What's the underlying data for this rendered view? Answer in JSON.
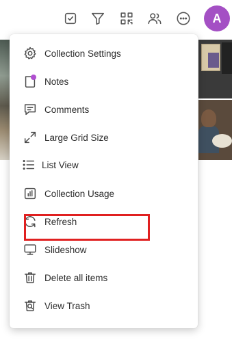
{
  "colors": {
    "avatar_bg": "#a450c4",
    "notes_dot": "#b04fd0",
    "highlight_border": "#e02020"
  },
  "toolbar": {
    "icons": [
      "checkbox-icon",
      "filter-icon",
      "qr-code-icon",
      "users-icon",
      "more-options-icon"
    ],
    "avatar_initial": "A"
  },
  "menu": {
    "items": [
      {
        "label": "Collection Settings",
        "icon": "gear-icon"
      },
      {
        "label": "Notes",
        "icon": "notes-icon"
      },
      {
        "label": "Comments",
        "icon": "comment-icon"
      },
      {
        "label": "Large Grid Size",
        "icon": "expand-icon"
      },
      {
        "label": "List View",
        "icon": "list-icon"
      },
      {
        "label": "Collection Usage",
        "icon": "bar-chart-icon"
      },
      {
        "label": "Refresh",
        "icon": "refresh-icon"
      },
      {
        "label": "Slideshow",
        "icon": "monitor-icon"
      },
      {
        "label": "Delete all items",
        "icon": "trash-icon"
      },
      {
        "label": "View Trash",
        "icon": "view-trash-icon"
      }
    ],
    "highlighted_item": "Collection Usage"
  }
}
